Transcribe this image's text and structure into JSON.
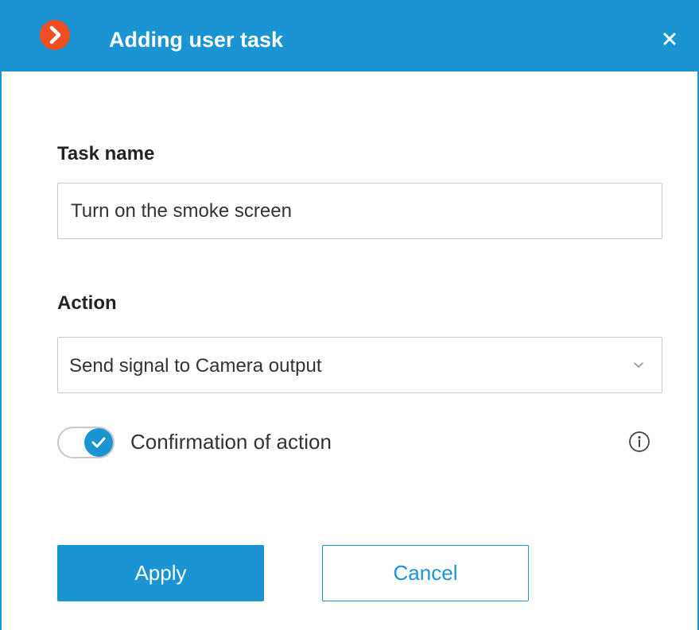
{
  "dialog": {
    "title": "Adding user task",
    "logo_icon": "chevron-right-logo-icon",
    "close_icon": "close-icon",
    "accent_color": "#1a94d2",
    "logo_color": "#f04e23"
  },
  "task": {
    "label": "Task name",
    "value": "Turn on the smoke screen"
  },
  "action": {
    "label": "Action",
    "selected": "Send signal to Camera output",
    "dropdown_icon": "chevron-down-icon"
  },
  "confirmation": {
    "label": "Confirmation of action",
    "enabled": true,
    "info_icon": "info-icon"
  },
  "buttons": {
    "apply": "Apply",
    "cancel": "Cancel"
  }
}
